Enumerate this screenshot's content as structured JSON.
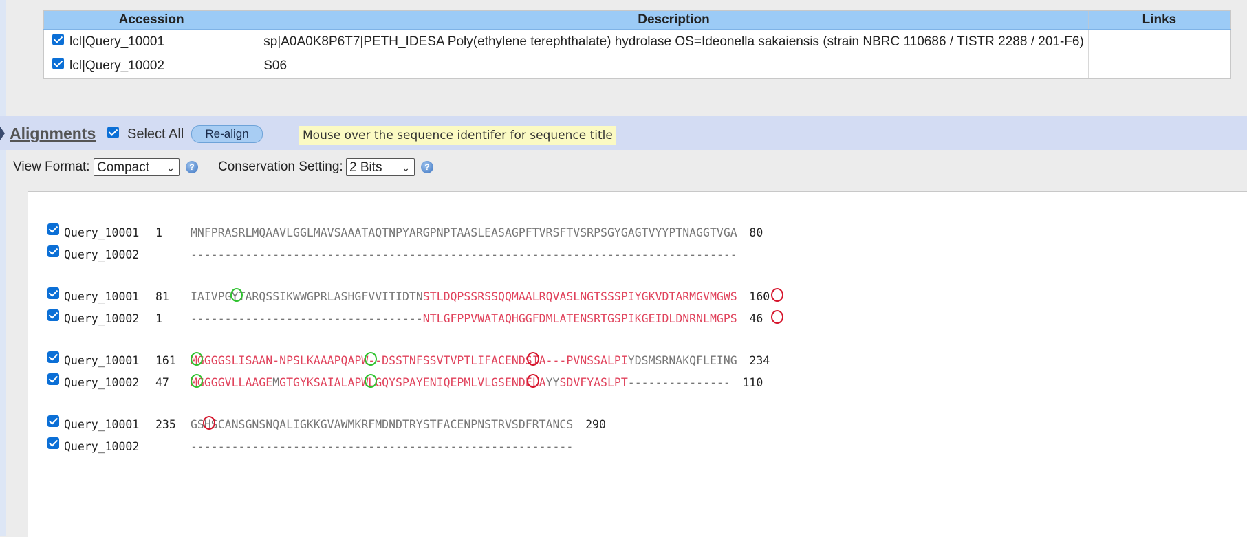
{
  "descriptions": {
    "headers": [
      "Accession",
      "Description",
      "Links"
    ],
    "rows": [
      {
        "accession": "lcl|Query_10001",
        "description": "sp|A0A0K8P6T7|PETH_IDESA Poly(ethylene terephthalate) hydrolase OS=Ideonella sakaiensis (strain NBRC 110686 / TISTR 2288 / 201-F6)",
        "checked": true
      },
      {
        "accession": "lcl|Query_10002",
        "description": "S06",
        "checked": true
      }
    ]
  },
  "alignments": {
    "title": "Alignments",
    "select_all_label": "Select All",
    "realign_label": "Re-align",
    "hint": "Mouse over the sequence identifer for sequence title"
  },
  "view": {
    "view_format_label": "View Format:",
    "view_format_value": "Compact",
    "conservation_label": "Conservation Setting:",
    "conservation_value": "2 Bits",
    "help_glyph": "?"
  },
  "alignment_blocks": [
    {
      "rows": [
        {
          "name": "Query_10001",
          "start": "1",
          "seq": [
            {
              "t": "MNFPRASRLMQAAVLGGLMAVSAAATAQTNPYARGPNPTAASLEASAGPFTVRSFTVSRPSGYGAGTVYYPTNAGGTVGA",
              "c": "g"
            }
          ],
          "end": "80"
        },
        {
          "name": "Query_10002",
          "start": "",
          "seq": [
            {
              "t": "--------------------------------------------------------------------------------",
              "c": "g"
            }
          ],
          "end": ""
        }
      ]
    },
    {
      "rows": [
        {
          "name": "Query_10001",
          "start": "81",
          "seq": [
            {
              "t": "IAIVPGYTARQSSIKWWGPRLASHGFVVITIDTN",
              "c": "g"
            },
            {
              "t": "STLDQPSSRSSQQMAALRQVASLNGTSSSPIYGKVDTARMGVMGWS",
              "c": "r"
            }
          ],
          "end": "160"
        },
        {
          "name": "Query_10002",
          "start": "1",
          "seq": [
            {
              "t": "----------------------------------",
              "c": "g"
            },
            {
              "t": "NTLGFPPVWATAQHGGFDMLATENSRTGSPIKGEIDLDNRNLMGPS",
              "c": "r"
            }
          ],
          "end": "46"
        }
      ]
    },
    {
      "rows": [
        {
          "name": "Query_10001",
          "start": "161",
          "seq": [
            {
              "t": "MGGGGSLISAAN-NPSLKAAAPQAPW--DSSTNFSSVTVPTLIFACENDSIA---PVNSSALPI",
              "c": "r"
            },
            {
              "t": "YDSMSRNAKQFLEING",
              "c": "g"
            }
          ],
          "end": "234"
        },
        {
          "name": "Query_10002",
          "start": "47",
          "seq": [
            {
              "t": "MGGGGVLLAAGE",
              "c": "r"
            },
            {
              "t": "M",
              "c": "g"
            },
            {
              "t": "GTGYKSAIALAPWLGQYSPAYENIQEPMLVLGSENDELA",
              "c": "r"
            },
            {
              "t": "YY",
              "c": "g"
            },
            {
              "t": "SDVFYASLPT",
              "c": "r"
            },
            {
              "t": "---------------",
              "c": "g"
            }
          ],
          "end": "110"
        }
      ]
    },
    {
      "rows": [
        {
          "name": "Query_10001",
          "start": "235",
          "seq": [
            {
              "t": "GSHSCANSGNSNQALIGKKGVAWMKRFMDNDTRYSTFACENPNSTRVSDFRTANCS",
              "c": "g"
            }
          ],
          "end": "290"
        },
        {
          "name": "Query_10002",
          "start": "",
          "seq": [
            {
              "t": "--------------------------------------------------------",
              "c": "g"
            }
          ],
          "end": ""
        }
      ]
    }
  ]
}
